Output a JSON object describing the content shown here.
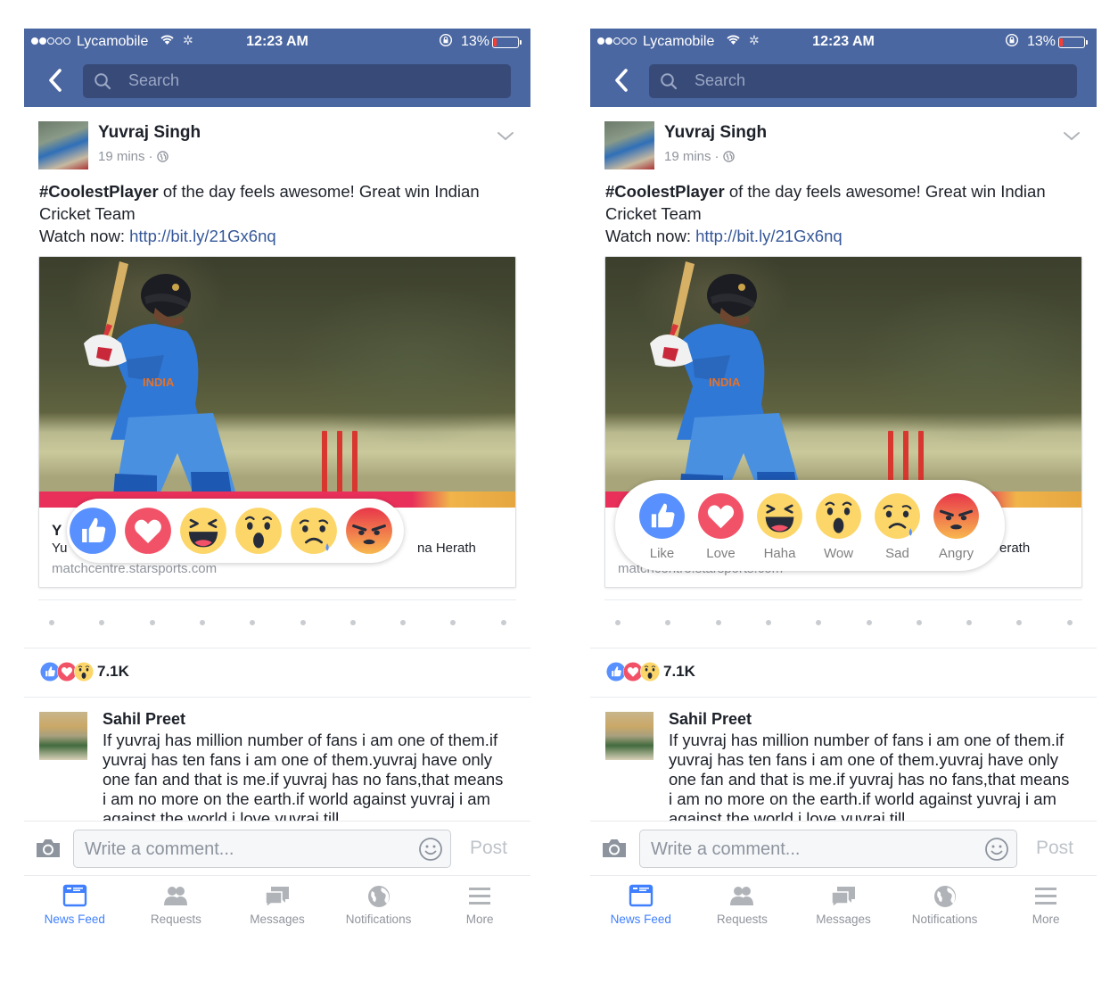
{
  "screens": [
    {
      "id": "left",
      "picker_style": "compact",
      "card_title_visible": "Y",
      "card_sub_left": "Yu",
      "card_sub_right": "na Herath"
    },
    {
      "id": "right",
      "picker_style": "labeled",
      "card_title_visible": "",
      "card_sub_left": "",
      "card_sub_right": "erath"
    }
  ],
  "status_bar": {
    "carrier": "Lycamobile",
    "signal_bars_filled": 2,
    "signal_bars_total": 5,
    "time": "12:23 AM",
    "battery_percent_label": "13%",
    "battery_level": 0.13,
    "icons": [
      "wifi-icon",
      "activity-spinner-icon",
      "rotation-lock-icon",
      "battery-icon"
    ]
  },
  "nav": {
    "back_icon": "chevron-left-icon",
    "search_placeholder": "Search"
  },
  "post": {
    "author": "Yuvraj Singh",
    "time": "19 mins",
    "separator": "·",
    "privacy_icon": "globe-icon",
    "hashtag": "#CoolestPlayer",
    "text_after_hashtag": " of the day feels awesome! Great win Indian Cricket Team",
    "watch_label": "Watch now: ",
    "link": "http://bit.ly/21Gx6nq",
    "options_icon": "chevron-down-icon",
    "card": {
      "domain": "matchcentre.starsports.com"
    },
    "reaction_summary": {
      "icons": [
        "like",
        "love",
        "wow"
      ],
      "count": "7.1K"
    }
  },
  "reactions": [
    {
      "key": "like",
      "label": "Like",
      "color": "#5890ff"
    },
    {
      "key": "love",
      "label": "Love",
      "color": "#f25268"
    },
    {
      "key": "haha",
      "label": "Haha",
      "color": "#fcd669"
    },
    {
      "key": "wow",
      "label": "Wow",
      "color": "#fcd669"
    },
    {
      "key": "sad",
      "label": "Sad",
      "color": "#fcd669"
    },
    {
      "key": "angry",
      "label": "Angry",
      "color": "#f0793f"
    }
  ],
  "comment": {
    "author": "Sahil Preet",
    "text": "If yuvraj has million number of fans i am one of them.if yuvraj has ten fans i am one of them.yuvraj have only one fan and that is me.if yuvraj has no fans,that means i am no more on the earth.if world against yuvraj i am against the world i love yuvraj till"
  },
  "composer": {
    "camera_icon": "camera-icon",
    "placeholder": "Write a comment...",
    "emoji_icon": "smiley-icon",
    "post_label": "Post"
  },
  "tabbar": {
    "items": [
      {
        "label": "News Feed",
        "icon": "news-feed-icon",
        "active": true
      },
      {
        "label": "Requests",
        "icon": "friend-requests-icon",
        "active": false
      },
      {
        "label": "Messages",
        "icon": "messages-icon",
        "active": false
      },
      {
        "label": "Notifications",
        "icon": "globe-icon",
        "active": false
      },
      {
        "label": "More",
        "icon": "hamburger-menu-icon",
        "active": false
      }
    ]
  },
  "colors": {
    "brand_blue": "#4b67a1",
    "search_bg": "#384a78",
    "link_blue": "#365899",
    "active_tab": "#4080ff",
    "inactive_gray": "#90949c",
    "battery_low": "#ff3b30"
  }
}
